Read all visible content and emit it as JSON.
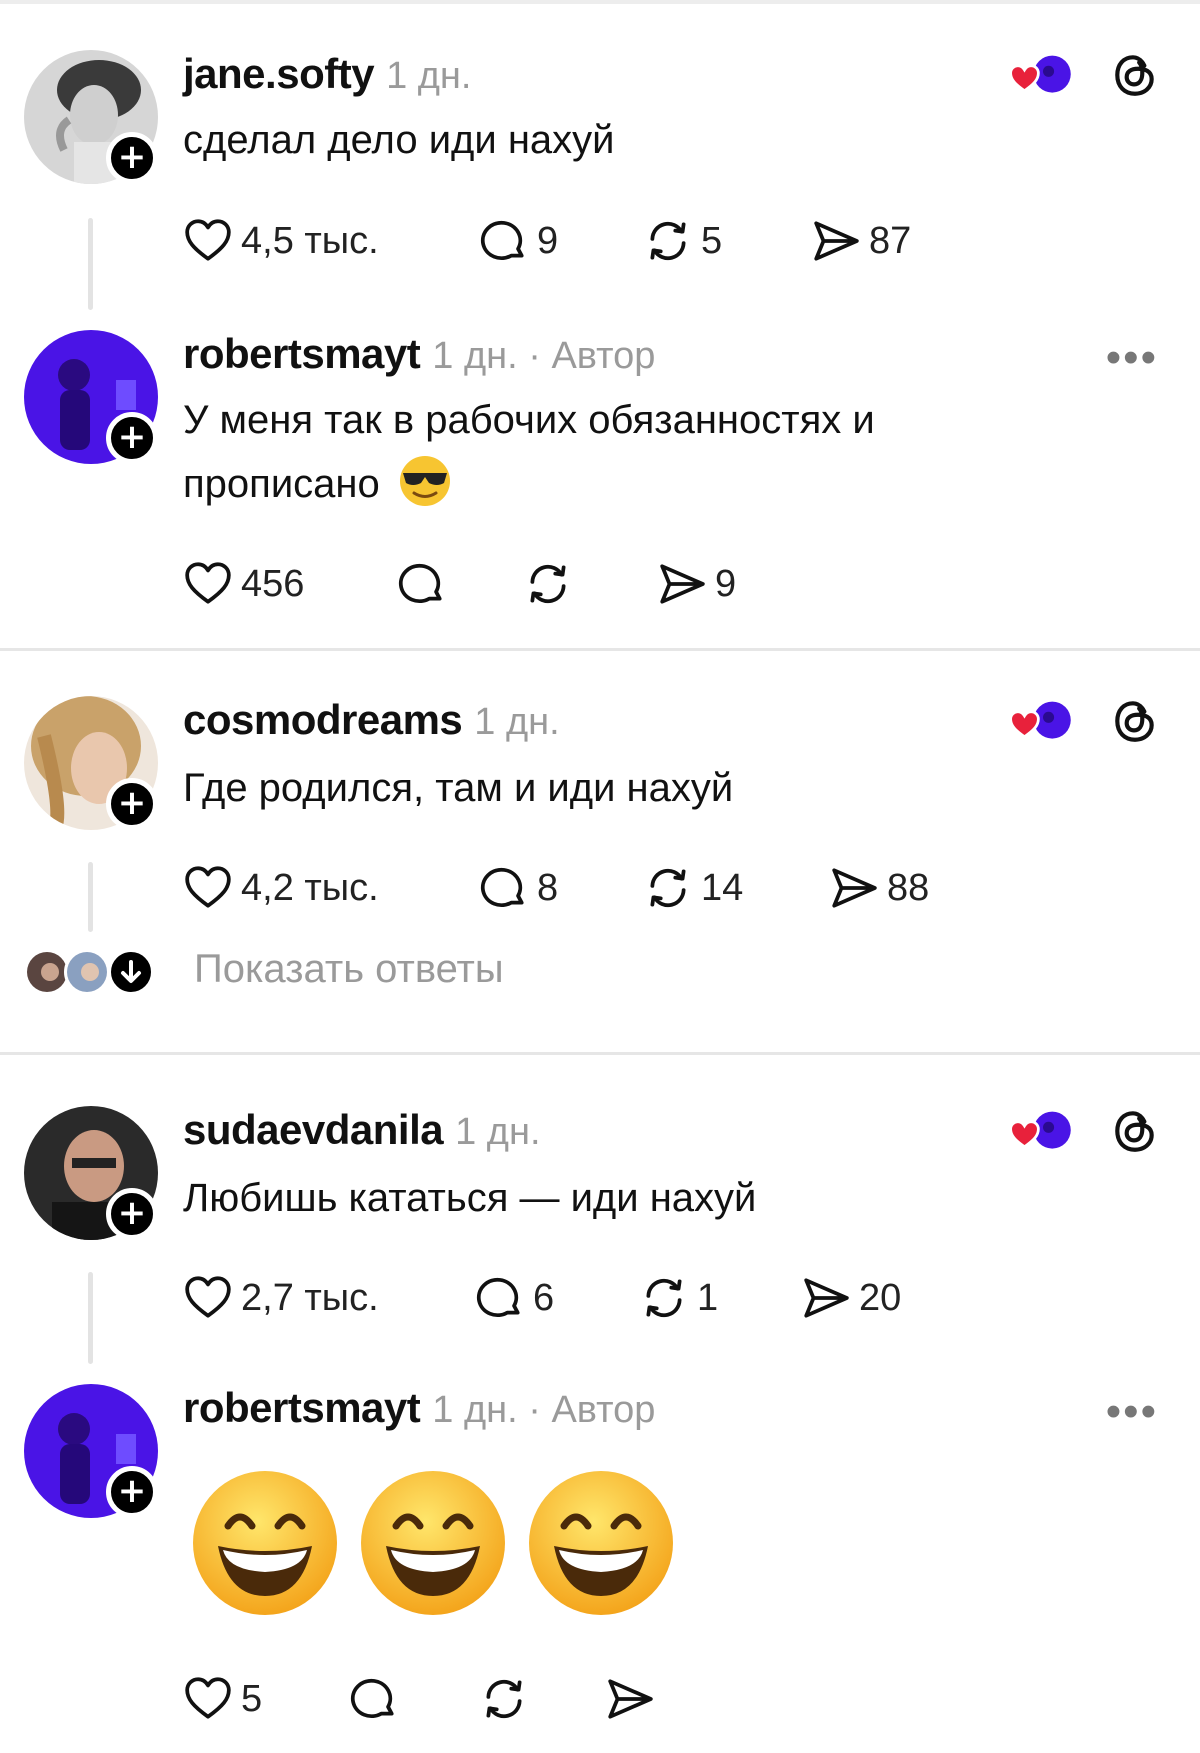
{
  "posts": [
    {
      "username": "jane.softy",
      "meta": "1 дн.",
      "text": "сделал дело иди нахуй",
      "likes": "4,5 тыс.",
      "comments": "9",
      "reposts": "5",
      "shares": "87"
    },
    {
      "username": "robertsmayt",
      "meta": "1 дн. · Автор",
      "text": "У меня так в рабочих обязанностях и прописано",
      "emoji_name": "smiling-face-with-sunglasses",
      "likes": "456",
      "comments": "",
      "reposts": "",
      "shares": "9"
    },
    {
      "username": "cosmodreams",
      "meta": "1 дн.",
      "text": "Где родился, там и иди нахуй",
      "likes": "4,2 тыс.",
      "comments": "8",
      "reposts": "14",
      "shares": "88"
    },
    {
      "username": "sudaevdanila",
      "meta": "1 дн.",
      "text": "Любишь кататься — иди нахуй",
      "likes": "2,7 тыс.",
      "comments": "6",
      "reposts": "1",
      "shares": "20"
    },
    {
      "username": "robertsmayt",
      "meta": "1 дн. · Автор",
      "emoji_name": "grinning-face-with-smiling-eyes",
      "emoji_count": 3,
      "likes": "5",
      "comments": "",
      "reposts": "",
      "shares": ""
    }
  ],
  "show_replies": "Показать ответы",
  "colors": {
    "heart": "#e8213b",
    "author_avatar": "#4a14e6",
    "muted": "#9a9a9a"
  },
  "icons": [
    "heart-icon",
    "comment-icon",
    "repost-icon",
    "share-icon",
    "threads-logo-icon",
    "more-icon",
    "plus-icon",
    "arrow-down-icon"
  ]
}
